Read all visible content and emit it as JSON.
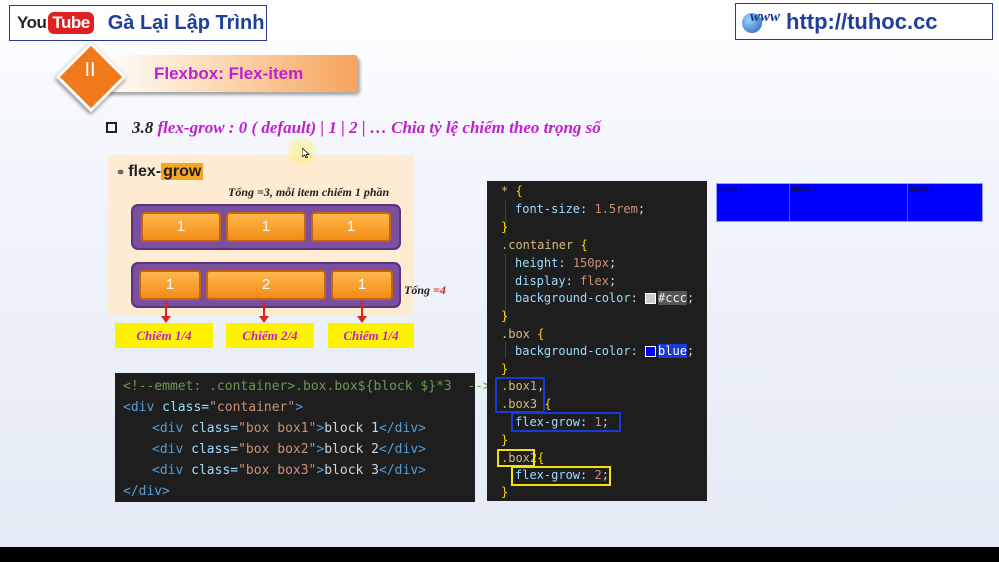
{
  "header": {
    "youtube_you": "You",
    "youtube_tube": "Tube",
    "channel_name": "Gà Lại Lập Trình",
    "site_www": "www",
    "site_url": "http://tuhoc.cc"
  },
  "section": {
    "number": "II",
    "title": "Flexbox: Flex-item"
  },
  "heading": {
    "number": "3.8",
    "text": "flex-grow :  0 ( default) |  1 | 2 | … Chia tỷ lệ chiếm theo trọng số"
  },
  "illustration": {
    "title_prefix": "flex-",
    "title_highlight": "grow",
    "note_top": "Tổng =3, mỗi item chiếm 1 phần",
    "row1": [
      "1",
      "1",
      "1"
    ],
    "row2": [
      "1",
      "2",
      "1"
    ],
    "note_bottom_prefix": "Tổng ",
    "note_bottom_value": "=4",
    "labels": [
      "Chiếm 1/4",
      "Chiếm 2/4",
      "Chiếm 1/4"
    ]
  },
  "html_code": {
    "line1": "<!--emmet: .container>.box.box${block $}*3  -->",
    "line2_open": "<div",
    "line2_attr": " class=",
    "line2_val": "\"container\"",
    "line2_close": ">",
    "rows": [
      {
        "cls": "\"box box1\"",
        "text": "block 1"
      },
      {
        "cls": "\"box box2\"",
        "text": "block 2"
      },
      {
        "cls": "\"box box3\"",
        "text": "block 3"
      }
    ],
    "div_tag": "<div",
    "div_close": "</div>",
    "end": "</div>"
  },
  "css_code": {
    "l1_sel": "*",
    "l1_brace": " {",
    "l2_prop": "font-size",
    "l2_val": "1.5rem",
    "l3": "}",
    "l4_sel": ".container",
    "l4_brace": " {",
    "l5_prop": "height",
    "l5_val": "150px",
    "l6_prop": "display",
    "l6_val": "flex",
    "l7_prop": "background-color",
    "l7_val": "#ccc",
    "l8": "}",
    "l9_sel": ".box",
    "l9_brace": " {",
    "l10_prop": "background-color",
    "l10_val": "blue",
    "l11": "}",
    "l12_sel": ".box1",
    "l12_pun": ",",
    "l13_sel": ".box3",
    "l13_brace": " {",
    "l14_prop": "flex-grow",
    "l14_val": "1",
    "l15": "}",
    "l16_sel": ".box2",
    "l16_brace": "{",
    "l17_prop": "flex-grow",
    "l17_val": "2",
    "l18": "}"
  },
  "preview": {
    "blocks": [
      "block 1",
      "block 2",
      "block 3"
    ]
  },
  "colors": {
    "accent_magenta": "#c21ed1",
    "banner_orange": "#f07a1a",
    "preview_blue": "#0000ff"
  }
}
